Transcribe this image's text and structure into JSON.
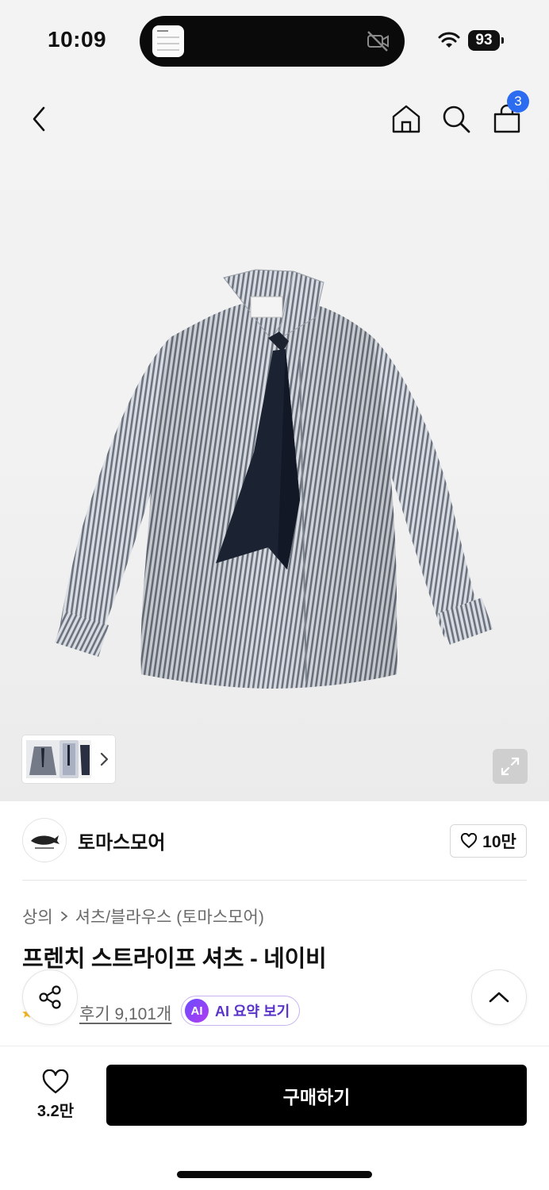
{
  "status_bar": {
    "time": "10:09",
    "battery": "93"
  },
  "header": {
    "back_icon": "chevron-left-icon",
    "home_icon": "home-icon",
    "search_icon": "search-icon",
    "cart_icon": "shopping-bag-icon",
    "cart_count": "3"
  },
  "gallery": {
    "image": "striped-shirt-with-navy-tie",
    "thumbnail_count": 3
  },
  "brand": {
    "name": "토마스모어",
    "likes": "10만"
  },
  "breadcrumb": {
    "category": "상의",
    "subcategory": "셔츠/블라우스 (토마스모어)"
  },
  "product": {
    "title": "프렌치 스트라이프 셔츠 - 네이비"
  },
  "reviews": {
    "link": "후기 9,101개",
    "ai_badge": "AI",
    "ai_summary": "AI 요약 보기"
  },
  "bottom_bar": {
    "wishlist_count": "3.2만",
    "buy_label": "구매하기"
  },
  "colors": {
    "accent": "#2b6cf0",
    "ai_purple": "#5a34c8",
    "buy_button": "#000000"
  }
}
